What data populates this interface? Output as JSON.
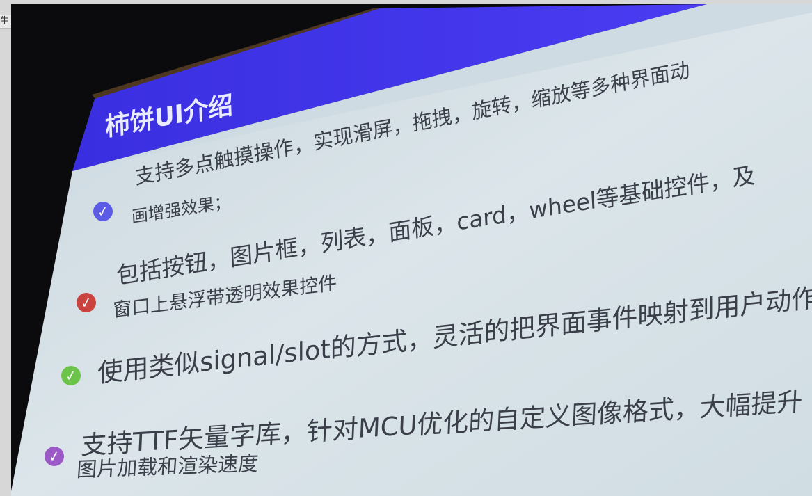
{
  "corner_label": "生",
  "slide": {
    "title": "柿饼UI介绍",
    "colors": {
      "header": "#3b30e6",
      "background": "#d9e4ea",
      "text": "#3b3f4a",
      "check_blue": "#5b5be6",
      "check_red": "#c9443f",
      "check_green": "#6cc34a",
      "check_purple": "#9b5ac6"
    },
    "bullets": [
      {
        "line1": "支持多点触摸操作，实现滑屏，拖拽，旋转，缩放等多种界面动",
        "line2": "画增强效果；"
      },
      {
        "line1": "包括按钮，图片框，列表，面板，card，wheel等基础控件，及",
        "line2": "窗口上悬浮带透明效果控件"
      },
      {
        "line1": "使用类似signal/slot的方式，灵活的把界面事件映射到用户动作",
        "line2": ""
      },
      {
        "line1": "支持TTF矢量字库，针对MCU优化的自定义图像格式，大幅提升",
        "line2": "图片加载和渲染速度"
      }
    ]
  }
}
